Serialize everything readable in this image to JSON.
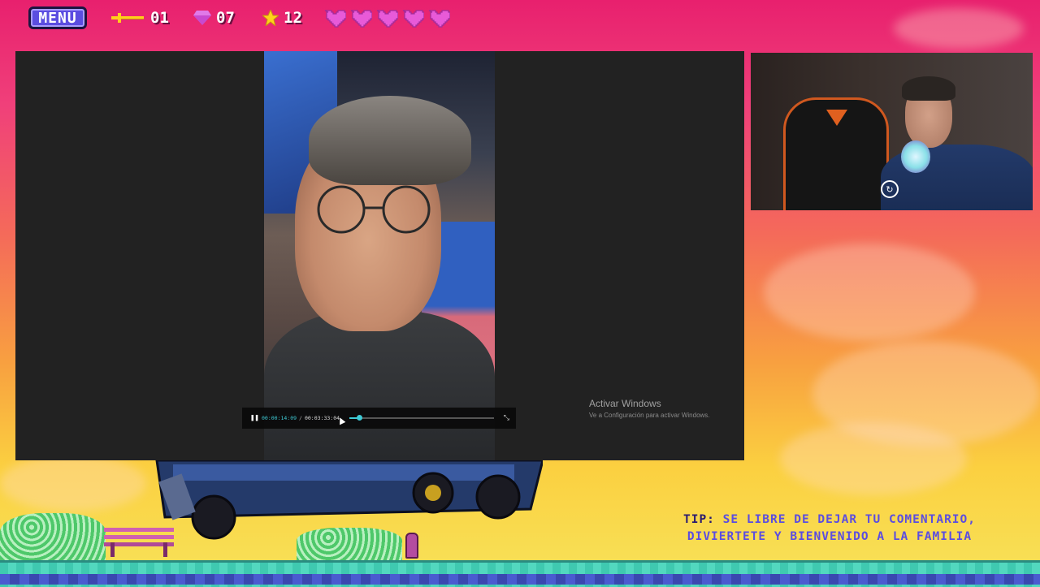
{
  "hud": {
    "menu_label": "MENU",
    "sword_count": "01",
    "gem_count": "07",
    "star_count": "12",
    "hearts": 5,
    "colors": {
      "heart": "#e85ad8",
      "gem": "#c84ad0",
      "star": "#ffd21a",
      "sword": "#ffcf1a"
    }
  },
  "player": {
    "current_time": "00:00:14:09",
    "separator": "/",
    "total_time": "00:03:33:04",
    "progress": 0.07,
    "pause_icon": "pause-icon",
    "expand_icon": "expand-icon"
  },
  "watermark": {
    "title": "Activar Windows",
    "subtitle": "Ve a Configuración para activar Windows."
  },
  "tip": {
    "label": "TIP:",
    "line1": "SE LIBRE DE DEJAR TU COMENTARIO,",
    "line2": "DIVIERTETE Y BIENVENIDO A LA FAMILIA"
  }
}
